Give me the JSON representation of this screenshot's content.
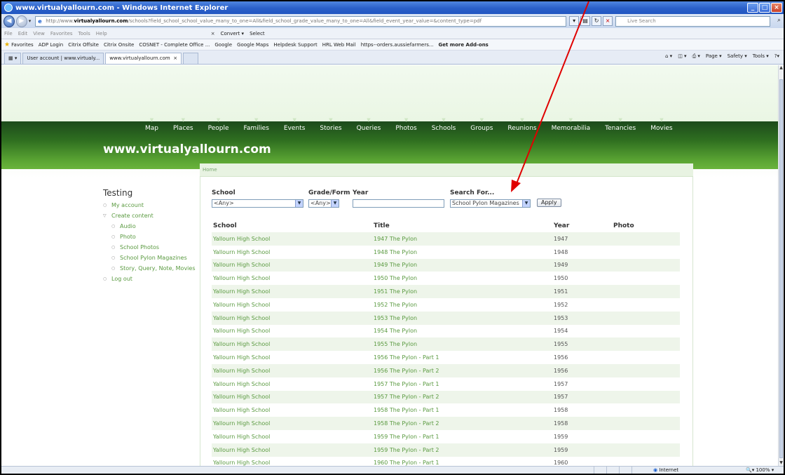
{
  "window": {
    "title": "www.virtualyallourn.com - Windows Internet Explorer"
  },
  "address_bar": {
    "url_prefix": "http://www.",
    "url_domain": "virtualyallourn.com",
    "url_rest": "/schools?field_school_school_value_many_to_one=All&field_school_grade_value_many_to_one=All&field_event_year_value=&content_type=pdf",
    "search_placeholder": "Live Search"
  },
  "menu_bar": {
    "items": [
      "File",
      "Edit",
      "View",
      "Favorites",
      "Tools",
      "Help"
    ],
    "convert": "Convert",
    "select": "Select"
  },
  "favorites_bar": {
    "favorites_label": "Favorites",
    "items": [
      "ADP Login",
      "Citrix Offsite",
      "Citrix Onsite",
      "COSNET - Complete Office ...",
      "Google",
      "Google Maps",
      "Helpdesk Support",
      "HRL Web Mail",
      "https--orders.aussiefarmers...",
      "Get more Add-ons"
    ]
  },
  "tabs": [
    {
      "label": "User account | www.virtualy..."
    },
    {
      "label": "www.virtualyallourn.com"
    }
  ],
  "command_bar": {
    "page": "Page",
    "safety": "Safety",
    "tools": "Tools"
  },
  "site": {
    "title": "www.virtualyallourn.com",
    "nav": [
      "Map",
      "Places",
      "People",
      "Families",
      "Events",
      "Stories",
      "Queries",
      "Photos",
      "Schools",
      "Groups",
      "Reunions",
      "Memorabilia",
      "Tenancies",
      "Movies"
    ],
    "breadcrumb": "Home"
  },
  "sidebar": {
    "title": "Testing",
    "my_account": "My account",
    "create_content": "Create content",
    "sub_items": [
      "Audio",
      "Photo",
      "School Photos",
      "School Pylon Magazines",
      "Story, Query, Note, Movies"
    ],
    "log_out": "Log out"
  },
  "filters": {
    "school_label": "School",
    "school_value": "<Any>",
    "grade_label": "Grade/Form",
    "grade_value": "<Any>",
    "year_label": "Year",
    "year_value": "",
    "search_label": "Search For...",
    "search_value": "School Pylon Magazines",
    "apply": "Apply"
  },
  "table": {
    "headers": [
      "School",
      "Title",
      "Year",
      "Photo"
    ],
    "rows": [
      {
        "school": "Yallourn High School",
        "title": "1947 The Pylon",
        "year": "1947"
      },
      {
        "school": "Yallourn High School",
        "title": "1948 The Pylon",
        "year": "1948"
      },
      {
        "school": "Yallourn High School",
        "title": "1949 The Pylon",
        "year": "1949"
      },
      {
        "school": "Yallourn High School",
        "title": "1950 The Pylon",
        "year": "1950"
      },
      {
        "school": "Yallourn High School",
        "title": "1951 The Pylon",
        "year": "1951"
      },
      {
        "school": "Yallourn High School",
        "title": "1952 The Pylon",
        "year": "1952"
      },
      {
        "school": "Yallourn High School",
        "title": "1953 The Pylon",
        "year": "1953"
      },
      {
        "school": "Yallourn High School",
        "title": "1954 The Pylon",
        "year": "1954"
      },
      {
        "school": "Yallourn High School",
        "title": "1955 The Pylon",
        "year": "1955"
      },
      {
        "school": "Yallourn High School",
        "title": "1956 The Pylon - Part 1",
        "year": "1956"
      },
      {
        "school": "Yallourn High School",
        "title": "1956 The Pylon - Part 2",
        "year": "1956"
      },
      {
        "school": "Yallourn High School",
        "title": "1957 The Pylon - Part 1",
        "year": "1957"
      },
      {
        "school": "Yallourn High School",
        "title": "1957 The Pylon - Part 2",
        "year": "1957"
      },
      {
        "school": "Yallourn High School",
        "title": "1958 The Pylon - Part 1",
        "year": "1958"
      },
      {
        "school": "Yallourn High School",
        "title": "1958 The Pylon - Part 2",
        "year": "1958"
      },
      {
        "school": "Yallourn High School",
        "title": "1959 The Pylon - Part 1",
        "year": "1959"
      },
      {
        "school": "Yallourn High School",
        "title": "1959 The Pylon - Part 2",
        "year": "1959"
      },
      {
        "school": "Yallourn High School",
        "title": "1960 The Pylon - Part 1",
        "year": "1960"
      }
    ]
  },
  "status_bar": {
    "zone": "Internet",
    "zoom": "100%"
  },
  "colors": {
    "link_green": "#5a9a40",
    "banner_green": "#2f6f20",
    "annotation_red": "#e00000"
  }
}
